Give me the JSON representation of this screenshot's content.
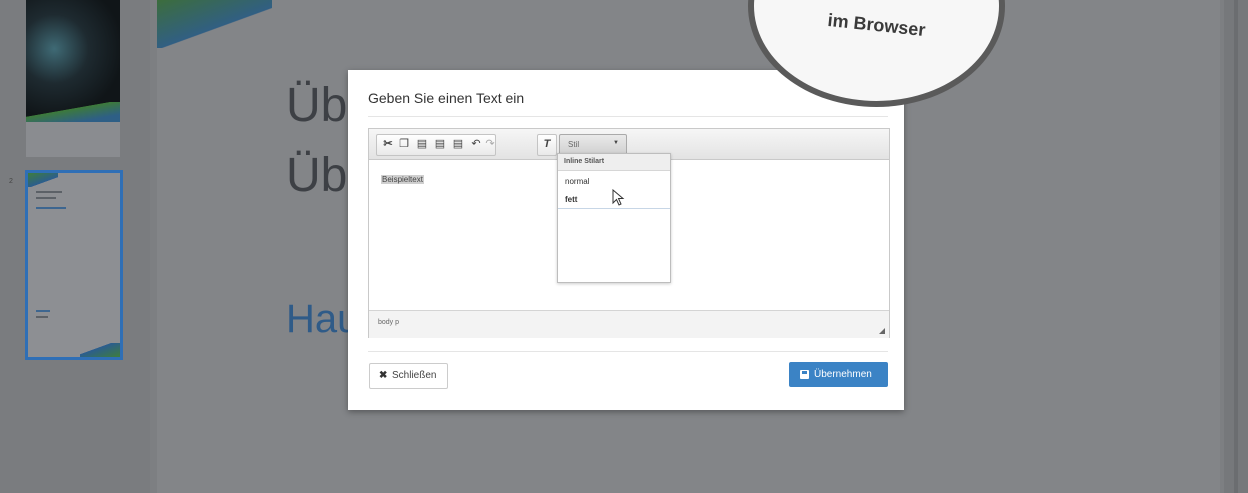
{
  "badge": {
    "text": "im Browser"
  },
  "background": {
    "title_line1": "Üb",
    "title_line2": "Üb",
    "subtitle": "Hau",
    "slide_number": "2"
  },
  "dialog": {
    "title": "Geben Sie einen Text ein",
    "toolbar": {
      "style_combo_label": "Stil",
      "buttons": [
        "cut-icon",
        "copy-icon",
        "paste-icon",
        "paste-text-icon",
        "paste-word-icon",
        "undo-icon",
        "redo-icon",
        "remove-format-icon"
      ]
    },
    "content_text": "Beispieltext",
    "path": "body  p",
    "close_label": "Schließen",
    "apply_label": "Übernehmen",
    "apply_color": "#3b83c5"
  },
  "style_dropdown": {
    "header": "Inline Stilart",
    "items": [
      {
        "label": "normal"
      },
      {
        "label": "fett"
      }
    ]
  }
}
